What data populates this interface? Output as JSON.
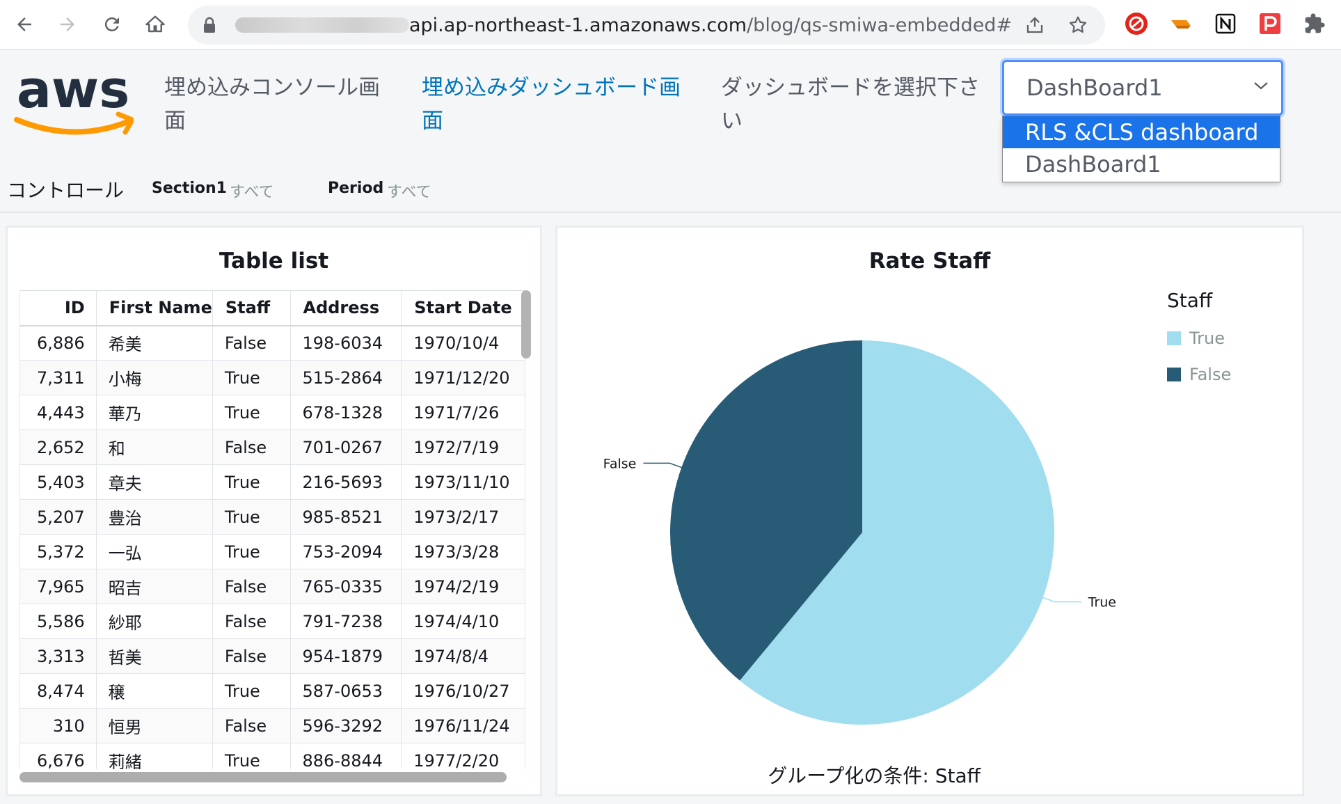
{
  "browser": {
    "url_domain_visible": "api.ap-northeast-1.amazonaws.com",
    "url_path": "/blog/qs-smiwa-embedded#"
  },
  "header": {
    "logo": "aws",
    "nav": [
      {
        "label_line1": "埋め込みコンソール画",
        "label_line2": "面"
      },
      {
        "label_line1": "埋め込みダッシュボード画",
        "label_line2": "面"
      },
      {
        "label_line1": "ダッシュボードを選択下さ",
        "label_line2": "い"
      }
    ],
    "select": {
      "value": "DashBoard1",
      "options": [
        "RLS &CLS dashboard",
        "DashBoard1"
      ],
      "highlighted": "RLS &CLS dashboard"
    }
  },
  "controls": {
    "title": "コントロール",
    "items": [
      {
        "label": "Section1",
        "value": "すべて"
      },
      {
        "label": "Period",
        "value": "すべて"
      }
    ]
  },
  "table_card": {
    "title": "Table list",
    "columns": [
      "ID",
      "First Name",
      "Staff",
      "Address",
      "Start Date"
    ],
    "rows": [
      [
        "6,886",
        "希美",
        "False",
        "198-6034",
        "1970/10/4"
      ],
      [
        "7,311",
        "小梅",
        "True",
        "515-2864",
        "1971/12/20"
      ],
      [
        "4,443",
        "華乃",
        "True",
        "678-1328",
        "1971/7/26"
      ],
      [
        "2,652",
        "和",
        "False",
        "701-0267",
        "1972/7/19"
      ],
      [
        "5,403",
        "章夫",
        "True",
        "216-5693",
        "1973/11/10"
      ],
      [
        "5,207",
        "豊治",
        "True",
        "985-8521",
        "1973/2/17"
      ],
      [
        "5,372",
        "一弘",
        "True",
        "753-2094",
        "1973/3/28"
      ],
      [
        "7,965",
        "昭吉",
        "False",
        "765-0335",
        "1974/2/19"
      ],
      [
        "5,586",
        "紗耶",
        "False",
        "791-7238",
        "1974/4/10"
      ],
      [
        "3,313",
        "哲美",
        "False",
        "954-1879",
        "1974/8/4"
      ],
      [
        "8,474",
        "穣",
        "True",
        "587-0653",
        "1976/10/27"
      ],
      [
        "310",
        "恒男",
        "False",
        "596-3292",
        "1976/11/24"
      ],
      [
        "6,676",
        "莉緒",
        "True",
        "886-8844",
        "1977/2/20"
      ]
    ]
  },
  "chart_card": {
    "title": "Rate Staff",
    "legend_title": "Staff",
    "group_condition": "グループ化の条件: Staff"
  },
  "chart_data": {
    "type": "pie",
    "title": "Rate Staff",
    "legend_title": "Staff",
    "legend_position": "right",
    "slices": [
      {
        "label": "True",
        "value": 61,
        "color": "#a0ddee"
      },
      {
        "label": "False",
        "value": 39,
        "color": "#275b76"
      }
    ]
  },
  "colors": {
    "accent": "#0073bb",
    "select_focus": "#4d90fe",
    "dropdown_highlight": "#1a73e8",
    "aws_orange": "#ff9900"
  }
}
